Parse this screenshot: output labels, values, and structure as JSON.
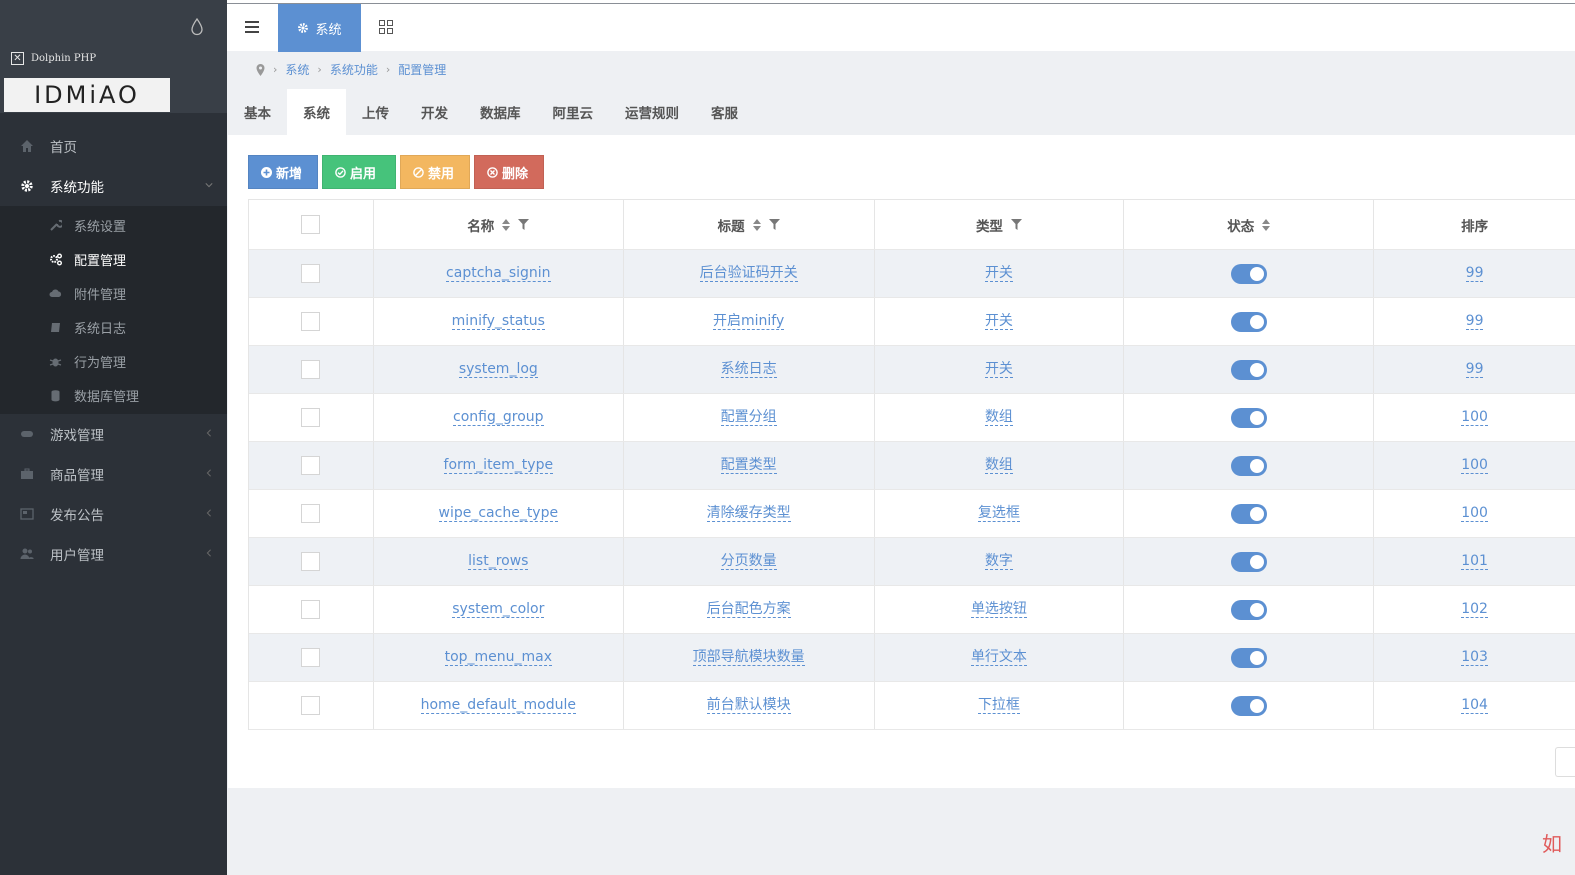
{
  "brand": {
    "small": "Dolphin PHP",
    "logo": "IDMiAO"
  },
  "sidebar": {
    "items": [
      {
        "label": "首页",
        "icon": "home-icon"
      },
      {
        "label": "系统功能",
        "icon": "gear-icon",
        "open": true
      }
    ],
    "sub_items": [
      {
        "label": "系统设置",
        "icon": "wrench-icon"
      },
      {
        "label": "配置管理",
        "icon": "cogs-icon",
        "active": true
      },
      {
        "label": "附件管理",
        "icon": "cloud-icon"
      },
      {
        "label": "系统日志",
        "icon": "book-icon"
      },
      {
        "label": "行为管理",
        "icon": "bug-icon"
      },
      {
        "label": "数据库管理",
        "icon": "database-icon"
      }
    ],
    "more_items": [
      {
        "label": "游戏管理",
        "icon": "gamepad-icon"
      },
      {
        "label": "商品管理",
        "icon": "briefcase-icon"
      },
      {
        "label": "发布公告",
        "icon": "newspaper-icon"
      },
      {
        "label": "用户管理",
        "icon": "users-icon"
      }
    ]
  },
  "topbar": {
    "system_label": "系统"
  },
  "breadcrumb": [
    "系统",
    "系统功能",
    "配置管理"
  ],
  "tabs": [
    "基本",
    "系统",
    "上传",
    "开发",
    "数据库",
    "阿里云",
    "运营规则",
    "客服"
  ],
  "active_tab": 1,
  "buttons": {
    "new": "新增",
    "enable": "启用",
    "disable": "禁用",
    "delete": "删除"
  },
  "table": {
    "headers": [
      "名称",
      "标题",
      "类型",
      "状态",
      "排序"
    ],
    "rows": [
      {
        "name": "captcha_signin",
        "title": "后台验证码开关",
        "type": "开关",
        "status": true,
        "sort": "99"
      },
      {
        "name": "minify_status",
        "title": "开启minify",
        "type": "开关",
        "status": true,
        "sort": "99"
      },
      {
        "name": "system_log",
        "title": "系统日志",
        "type": "开关",
        "status": true,
        "sort": "99"
      },
      {
        "name": "config_group",
        "title": "配置分组",
        "type": "数组",
        "status": true,
        "sort": "100"
      },
      {
        "name": "form_item_type",
        "title": "配置类型",
        "type": "数组",
        "status": true,
        "sort": "100"
      },
      {
        "name": "wipe_cache_type",
        "title": "清除缓存类型",
        "type": "复选框",
        "status": true,
        "sort": "100"
      },
      {
        "name": "list_rows",
        "title": "分页数量",
        "type": "数字",
        "status": true,
        "sort": "101"
      },
      {
        "name": "system_color",
        "title": "后台配色方案",
        "type": "单选按钮",
        "status": true,
        "sort": "102"
      },
      {
        "name": "top_menu_max",
        "title": "顶部导航模块数量",
        "type": "单行文本",
        "status": true,
        "sort": "103"
      },
      {
        "name": "home_default_module",
        "title": "前台默认模块",
        "type": "下拉框",
        "status": true,
        "sort": "104"
      }
    ]
  },
  "watermark": "如",
  "colors": {
    "primary": "#5c90d2",
    "success": "#46c37b",
    "warning": "#f3b760",
    "danger": "#d26a5c",
    "sidebar": "#2c3138"
  }
}
